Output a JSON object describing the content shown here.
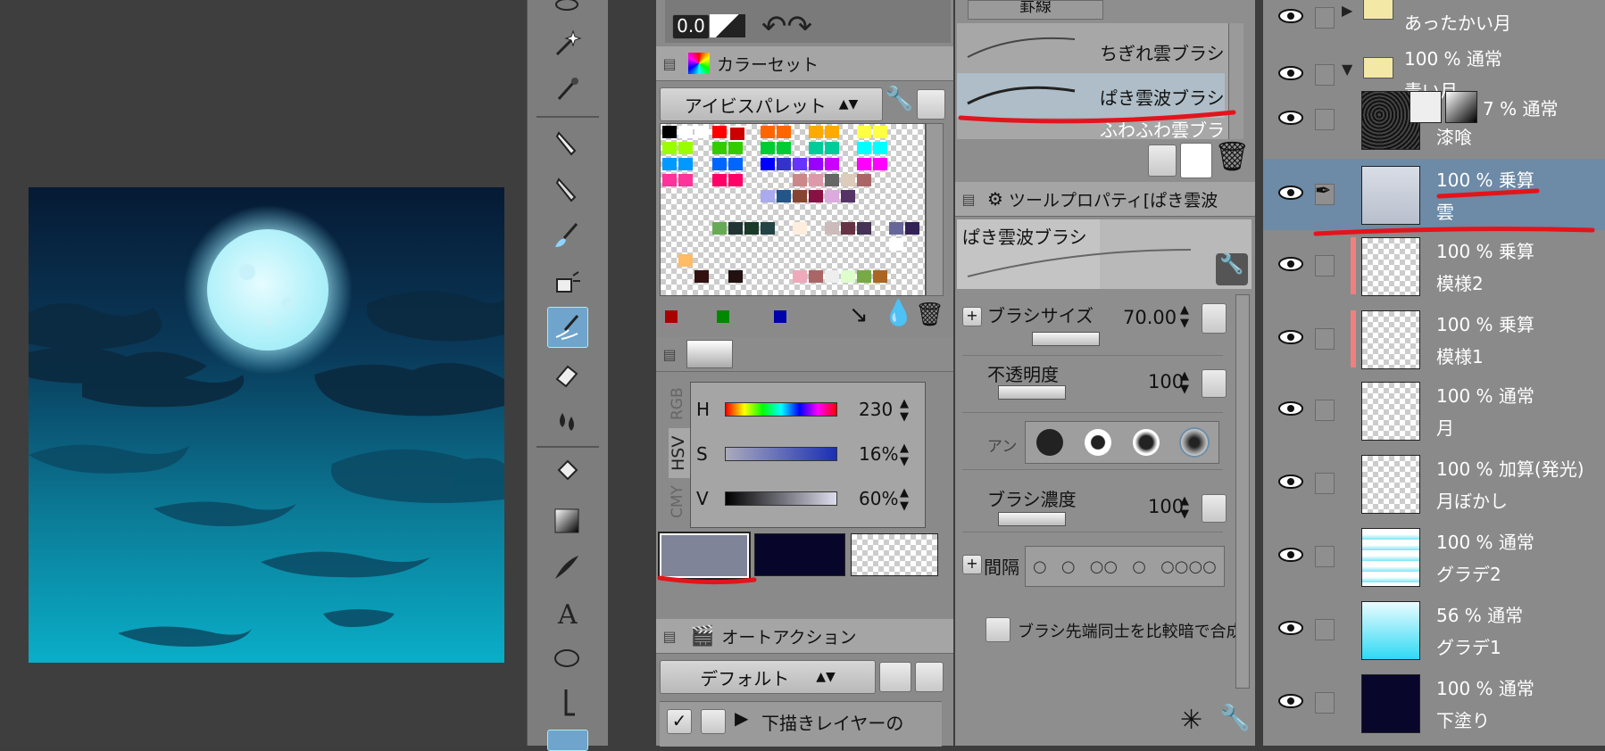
{
  "top_toolbar": {
    "value": "0.0"
  },
  "color_set": {
    "tab_label": "カラーセット",
    "palette_name": "アイビスパレット"
  },
  "brush_list": {
    "items": [
      "ちぎれ雲ブラシ",
      "ぱき雲波ブラシ",
      "ふわふわ雲ブラシ"
    ],
    "top_label": "罫線",
    "selected": "ぱき雲波ブラシ"
  },
  "tool_property": {
    "tab_label": "ツールプロパティ[ぱき雲波",
    "preview_name": "ぱき雲波ブラシ",
    "brush_size_label": "ブラシサイズ",
    "brush_size_value": "70.00",
    "opacity_label": "不透明度",
    "opacity_value": "100",
    "antialias_label": "アン",
    "density_label": "ブラシ濃度",
    "density_value": "100",
    "interval_label": "間隔",
    "blend_label": "ブラシ先端同士を比較暗で合成"
  },
  "color_slider": {
    "tabs": [
      "RGB",
      "HSV",
      "CMY"
    ],
    "h_label": "H",
    "h_value": "230",
    "s_label": "S",
    "s_value": "16%",
    "v_label": "V",
    "v_value": "60%",
    "main_color": "#7f8499",
    "sub_color": "#07062a"
  },
  "auto_action": {
    "tab_label": "オートアクション",
    "set_name": "デフォルト",
    "first_item": "下描きレイヤーの"
  },
  "layers": [
    {
      "mode": "",
      "name": "あったかい月",
      "type": "folder"
    },
    {
      "mode": "100 % 通常",
      "name": "青い月",
      "type": "folder"
    },
    {
      "mode": "7 % 通常",
      "name": "漆喰"
    },
    {
      "mode": "100 % 乗算",
      "name": "雲",
      "selected": true
    },
    {
      "mode": "100 % 乗算",
      "name": "模様2"
    },
    {
      "mode": "100 % 乗算",
      "name": "模様1"
    },
    {
      "mode": "100 % 通常",
      "name": "月"
    },
    {
      "mode": "100 % 加算(発光)",
      "name": "月ぼかし"
    },
    {
      "mode": "100 % 通常",
      "name": "グラデ2"
    },
    {
      "mode": "56 % 通常",
      "name": "グラデ1"
    },
    {
      "mode": "100 % 通常",
      "name": "下塗り"
    }
  ],
  "colors": {
    "accent": "#e3141b",
    "panel": "#8a8a8a",
    "selected_layer": "#6d8aa6"
  }
}
